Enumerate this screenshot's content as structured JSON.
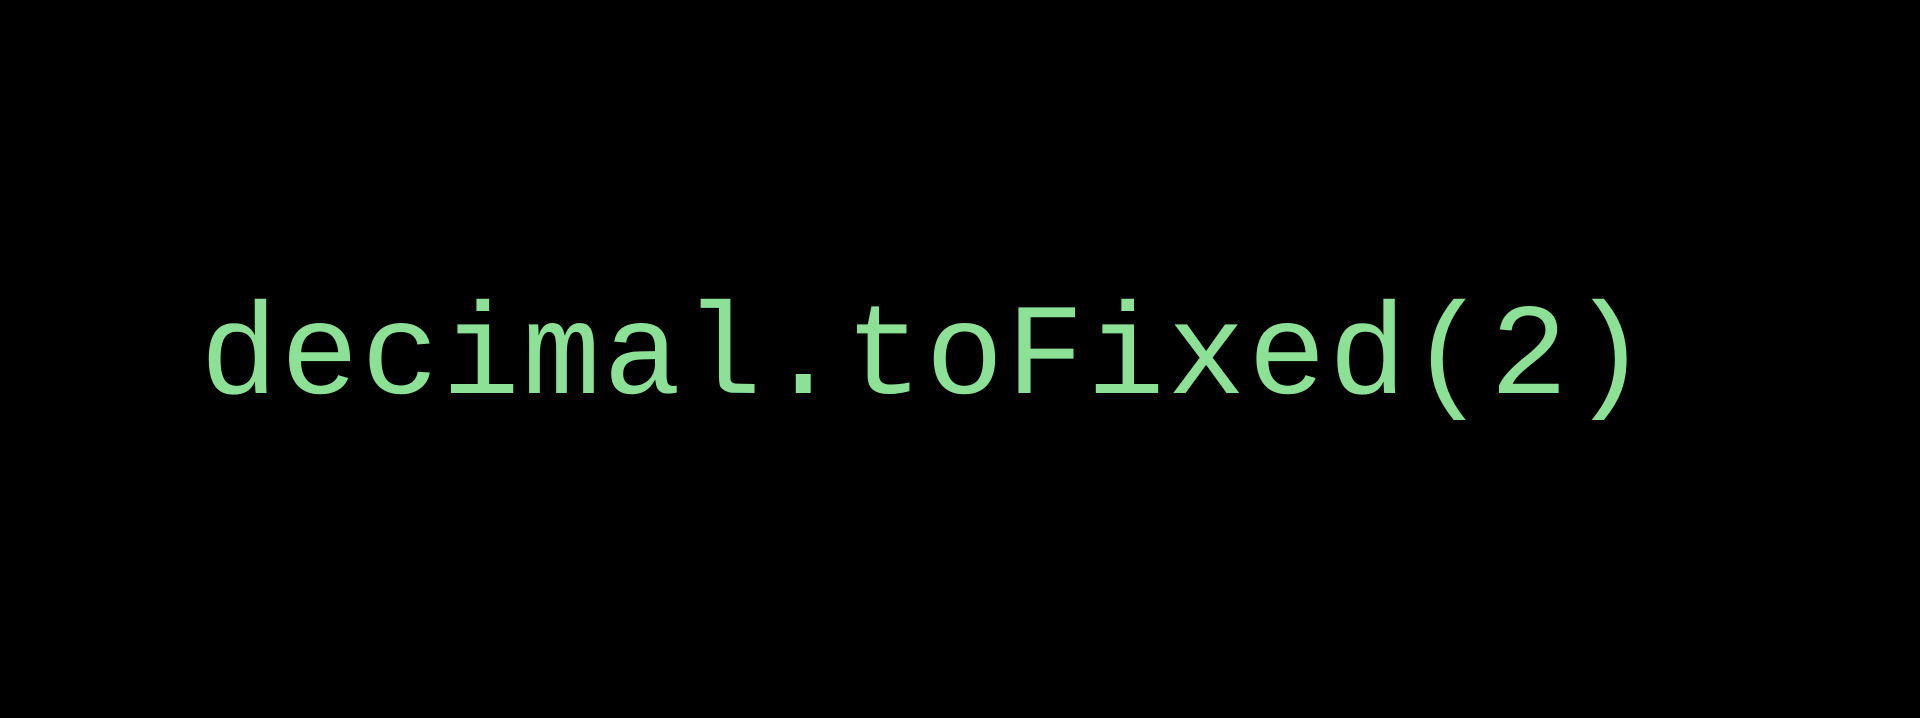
{
  "code": {
    "expression": "decimal.toFixed(2)"
  }
}
